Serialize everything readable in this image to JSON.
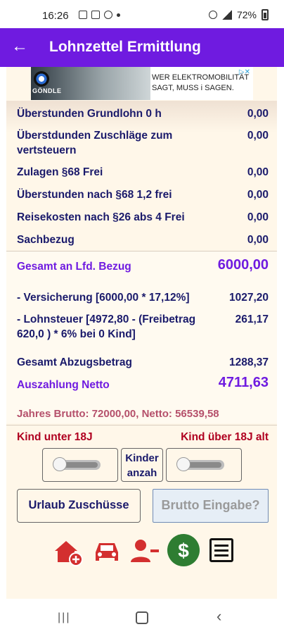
{
  "status_bar": {
    "time": "16:26",
    "battery": "72%"
  },
  "app_bar": {
    "title": "Lohnzettel Ermittlung",
    "back_icon": "arrow-left-icon"
  },
  "ad": {
    "brand": "GÖNDLE",
    "line1": "WER ELEKTROMOBILITÄT",
    "line2": "SAGT, MUSS i SAGEN."
  },
  "rows": [
    {
      "label": "Überstunden Grundlohn 0 h",
      "value": "0,00"
    },
    {
      "label": "Überstdunden Zuschläge zum vertsteuern",
      "value": "0,00"
    },
    {
      "label": "Zulagen §68 Frei",
      "value": "0,00"
    },
    {
      "label": "Überstunden nach §68 1,2 frei",
      "value": "0,00"
    },
    {
      "label": "Reisekosten nach §26 abs 4 Frei",
      "value": "0,00"
    },
    {
      "label": "Sachbezug",
      "value": "0,00"
    }
  ],
  "gesamt_lfd": {
    "label": "Gesamt an Lfd. Bezug",
    "value": "6000,00"
  },
  "versicherung": {
    "label": "- Versicherung [6000,00 * 17,12%]",
    "value": "1027,20"
  },
  "lohnsteuer": {
    "label": "- Lohnsteuer [4972,80 - (Freibetrag 620,0 ) * 6% bei 0 Kind]",
    "value": "261,17"
  },
  "gesamt_abzug": {
    "label": "Gesamt Abzugsbetrag",
    "value": "1288,37"
  },
  "netto": {
    "label": "Auszahlung Netto",
    "value": "4711,63"
  },
  "jahres": "Jahres Brutto: 72000,00, Netto: 56539,58",
  "kind_unter": "Kind unter 18J",
  "kind_ueber": "Kind über 18J alt",
  "kinder_btn": {
    "line1": "Kinder",
    "line2": "anzah"
  },
  "urlaub_btn": "Urlaub Zuschüsse",
  "brutto_btn": "Brutto Eingabe?",
  "toolbar_icons": [
    "house-add-icon",
    "car-icon",
    "person-remove-icon",
    "money-bag-icon",
    "list-icon"
  ],
  "colors": {
    "appbar": "#6f1be0",
    "accent_purple": "#6f1be0",
    "label_navy": "#1a1a6b",
    "kind_red": "#b00020",
    "icon_red": "#d32f2f"
  }
}
